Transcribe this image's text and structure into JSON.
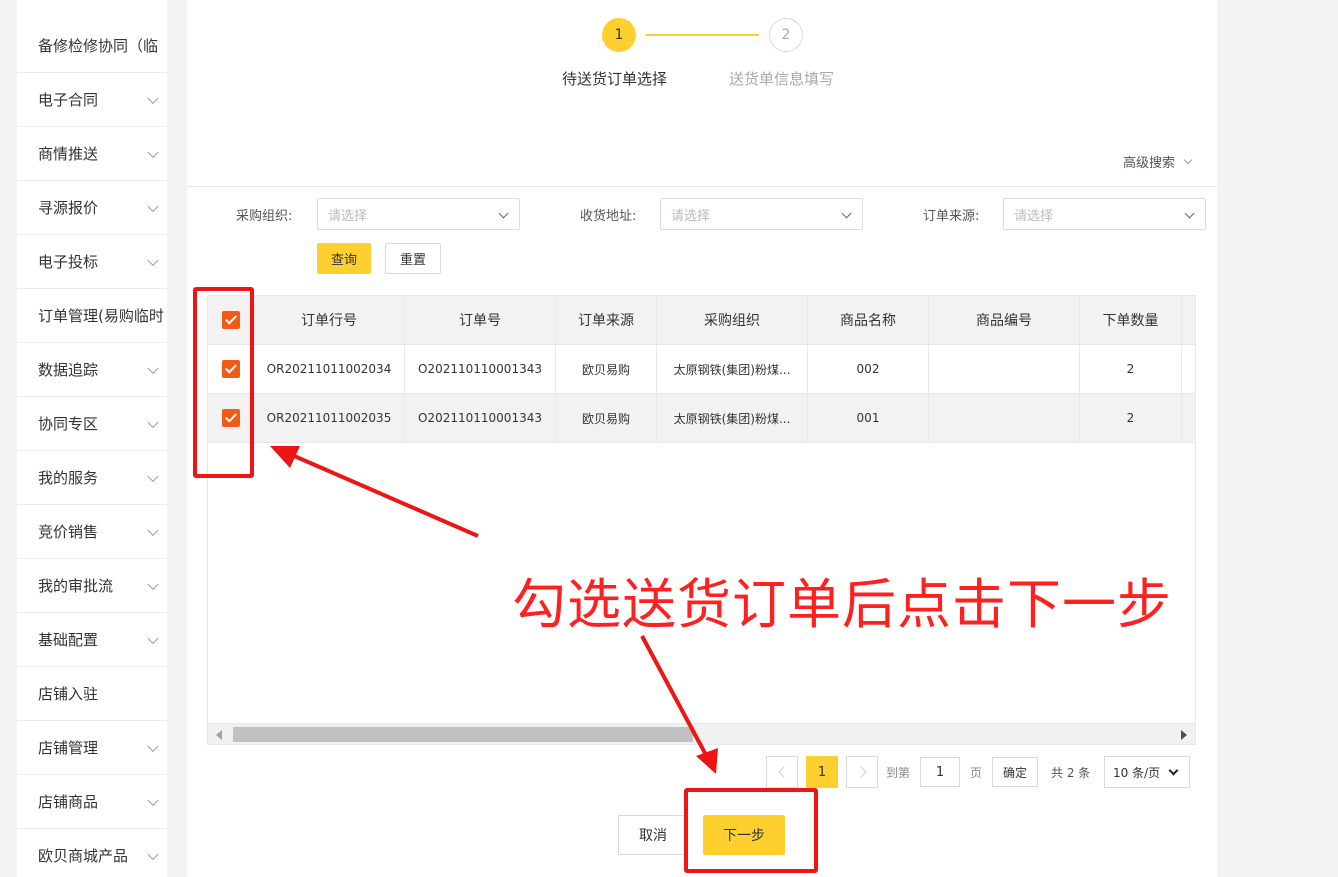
{
  "sidebar": {
    "items": [
      {
        "label": "备修检修协同（临",
        "chevron": false
      },
      {
        "label": "电子合同",
        "chevron": true
      },
      {
        "label": "商情推送",
        "chevron": true
      },
      {
        "label": "寻源报价",
        "chevron": true
      },
      {
        "label": "电子投标",
        "chevron": true
      },
      {
        "label": "订单管理(易购临时",
        "chevron": false
      },
      {
        "label": "数据追踪",
        "chevron": true
      },
      {
        "label": "协同专区",
        "chevron": true
      },
      {
        "label": "我的服务",
        "chevron": true
      },
      {
        "label": "竞价销售",
        "chevron": true
      },
      {
        "label": "我的审批流",
        "chevron": true
      },
      {
        "label": "基础配置",
        "chevron": true
      },
      {
        "label": "店铺入驻",
        "chevron": false
      },
      {
        "label": "店铺管理",
        "chevron": true
      },
      {
        "label": "店铺商品",
        "chevron": true
      },
      {
        "label": "欧贝商城产品",
        "chevron": true
      }
    ]
  },
  "steps": [
    {
      "number": "1",
      "label": "待送货订单选择",
      "active": true
    },
    {
      "number": "2",
      "label": "送货单信息填写",
      "active": false
    }
  ],
  "advanced_search": "高级搜索",
  "filters": {
    "purchase_org": {
      "label": "采购组织:",
      "placeholder": "请选择"
    },
    "address": {
      "label": "收货地址:",
      "placeholder": "请选择"
    },
    "source": {
      "label": "订单来源:",
      "placeholder": "请选择"
    },
    "query_button": "查询",
    "reset_button": "重置"
  },
  "table": {
    "columns": [
      "订单行号",
      "订单号",
      "订单来源",
      "采购组织",
      "商品名称",
      "商品编号",
      "下单数量"
    ],
    "rows": [
      {
        "checked": true,
        "line_no": "OR20211011002034",
        "order_no": "O202110110001343",
        "source": "欧贝易购",
        "org": "太原钢铁(集团)粉煤...",
        "name": "002",
        "code": "",
        "qty": "2"
      },
      {
        "checked": true,
        "line_no": "OR20211011002035",
        "order_no": "O202110110001343",
        "source": "欧贝易购",
        "org": "太原钢铁(集团)粉煤...",
        "name": "001",
        "code": "",
        "qty": "2"
      }
    ]
  },
  "pagination": {
    "current_page": "1",
    "goto_label": "到第",
    "goto_value": "1",
    "page_unit": "页",
    "confirm": "确定",
    "total": "共 2 条",
    "page_size": "10 条/页"
  },
  "footer": {
    "cancel": "取消",
    "next": "下一步"
  },
  "annotation": {
    "text": "勾选送货订单后点击下一步",
    "color": "#ff2020"
  },
  "colors": {
    "accent": "#fdd02f",
    "checkbox": "#f25a15"
  }
}
